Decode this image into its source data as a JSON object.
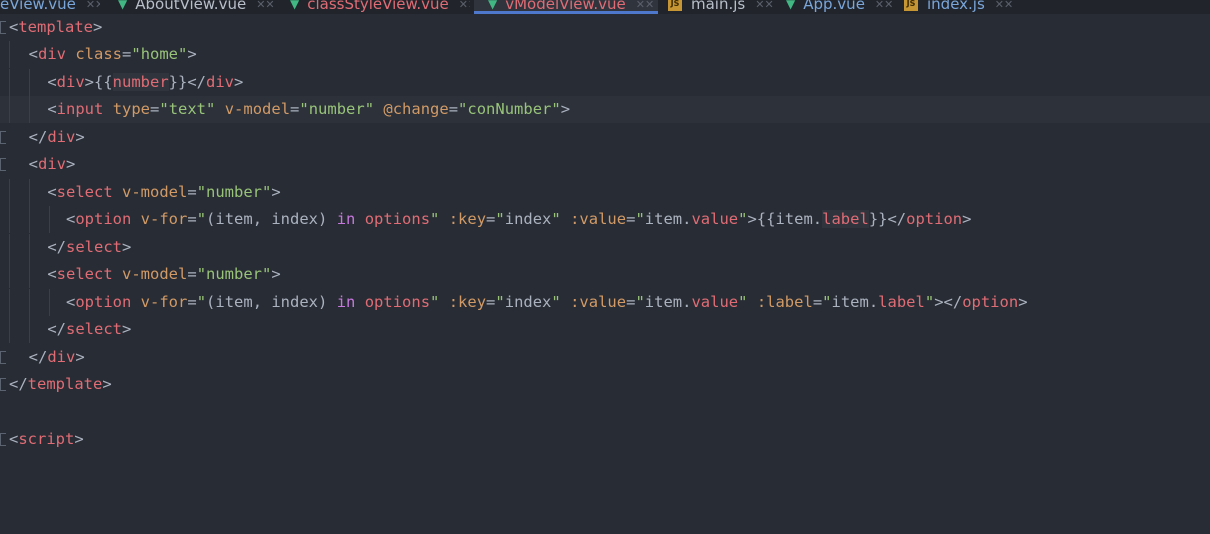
{
  "tabs": [
    {
      "label": "eView.vue",
      "icon": "vue-icon",
      "color": "#7aa6da",
      "active": false
    },
    {
      "label": "AboutView.vue",
      "icon": "vue-icon",
      "color": "#b8bfc9",
      "active": false
    },
    {
      "label": "classStyleView.vue",
      "icon": "vue-icon",
      "color": "#e06c75",
      "active": false
    },
    {
      "label": "vModelView.vue",
      "icon": "vue-icon",
      "color": "#e06c75",
      "active": true
    },
    {
      "label": "main.js",
      "icon": "js-icon",
      "color": "#b8bfc9",
      "active": false
    },
    {
      "label": "App.vue",
      "icon": "vue-icon",
      "color": "#7aa6da",
      "active": false
    },
    {
      "label": "index.js",
      "icon": "js-icon",
      "color": "#7aa6da",
      "active": false
    }
  ],
  "code": {
    "l1": {
      "t1": "<",
      "t2": "template",
      "t3": ">"
    },
    "l2": {
      "a": "  <",
      "b": "div",
      "c": " ",
      "d": "class",
      "e": "=",
      "f": "\"home\"",
      "g": ">"
    },
    "l3": {
      "a": "    <",
      "b": "div",
      "c": ">{{",
      "d": "number",
      "e": "}}</",
      "f": "div",
      "g": ">"
    },
    "l4": {
      "a": "    <",
      "b": "input",
      "c": " ",
      "d": "type",
      "e": "=",
      "f": "\"text\"",
      "g": " ",
      "h": "v-model",
      "i": "=",
      "j": "\"number\"",
      "k": " ",
      "l": "@change",
      "m": "=",
      "n": "\"conNumber\"",
      "o": ">"
    },
    "l5": {
      "a": "  </",
      "b": "div",
      "c": ">"
    },
    "l6": {
      "a": "  <",
      "b": "div",
      "c": ">"
    },
    "l7": {
      "a": "    <",
      "b": "select",
      "c": " ",
      "d": "v-model",
      "e": "=",
      "f": "\"number\"",
      "g": ">"
    },
    "l8": {
      "a": "      <",
      "b": "option",
      "c": " ",
      "d": "v-for",
      "e": "=",
      "f": "\"",
      "g": "(item, index) ",
      "h": "in",
      "i": " ",
      "j": "options",
      "k": "\"",
      "l": " ",
      "m": ":key",
      "n": "=",
      "o": "\"",
      "p": "index",
      "q": "\"",
      "r": " ",
      "s": ":value",
      "t": "=",
      "u": "\"",
      "v": "item.",
      "w": "value",
      "x": "\"",
      "y": ">{{",
      "z": "item.",
      "aa": "label",
      "ab": "}}</",
      "ac": "option",
      "ad": ">"
    },
    "l9": {
      "a": "    </",
      "b": "select",
      "c": ">"
    },
    "l10": {
      "a": "    <",
      "b": "select",
      "c": " ",
      "d": "v-model",
      "e": "=",
      "f": "\"number\"",
      "g": ">"
    },
    "l11": {
      "a": "      <",
      "b": "option",
      "c": " ",
      "d": "v-for",
      "e": "=",
      "f": "\"",
      "g": "(item, index) ",
      "h": "in",
      "i": " ",
      "j": "options",
      "k": "\"",
      "l": " ",
      "m": ":key",
      "n": "=",
      "o": "\"",
      "p": "index",
      "q": "\"",
      "r": " ",
      "s": ":value",
      "t": "=",
      "u": "\"",
      "v": "item.",
      "w": "value",
      "x": "\"",
      "y": " ",
      "s2": ":label",
      "t2": "=",
      "u2": "\"",
      "v2": "item.",
      "w2": "label",
      "x2": "\"",
      "y2": "></",
      "ac": "option",
      "ad": ">"
    },
    "l12": {
      "a": "    </",
      "b": "select",
      "c": ">"
    },
    "l13": {
      "a": "  </",
      "b": "div",
      "c": ">"
    },
    "l14": {
      "a": "</",
      "b": "template",
      "c": ">"
    },
    "l16": {
      "a": "<",
      "b": "script",
      "c": ">"
    }
  }
}
